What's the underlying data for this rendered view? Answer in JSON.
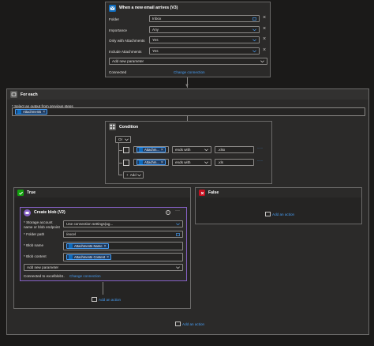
{
  "trigger": {
    "title": "When a new email arrives (V3)",
    "fields": [
      {
        "label": "Folder",
        "value": "Inbox"
      },
      {
        "label": "Importance",
        "value": "Any"
      },
      {
        "label": "Only with Attachments",
        "value": "Yes"
      },
      {
        "label": "Include Attachments",
        "value": "Yes"
      }
    ],
    "add_param": "Add new parameter",
    "connected_label": "Connected",
    "change_connection": "Change connection"
  },
  "foreach": {
    "title": "For each",
    "select_label": "* Select an output from previous steps",
    "token": "Attachments"
  },
  "condition": {
    "title": "Condition",
    "operator": "Or",
    "rows": [
      {
        "token": "Attachm...",
        "op": "ends with",
        "value": ".xlsx"
      },
      {
        "token": "Attachm...",
        "op": "ends with",
        "value": ".xls"
      }
    ],
    "add_label": "Add"
  },
  "true_branch": {
    "title": "True",
    "add_action": "Add an action",
    "blob": {
      "title": "Create blob (V2)",
      "fields": [
        {
          "label": "* Storage account name or blob endpoint",
          "value": "Use connection settings(ag..."
        },
        {
          "label": "* Folder path",
          "value": "/excel"
        },
        {
          "label": "* Blob name",
          "token": "Attachments Name"
        },
        {
          "label": "* Blob content",
          "token": "Attachments Content"
        }
      ],
      "add_param": "Add new parameter",
      "connected_label": "Connected to excelblob1.",
      "change_connection": "Change connection"
    }
  },
  "false_branch": {
    "title": "False",
    "add_action": "Add an action"
  },
  "bottom": {
    "add_action": "Add an action"
  },
  "colors": {
    "outlook_blue": "#0f6cbd",
    "control_gray": "#5c5b59",
    "true_green": "#13a10e",
    "false_red": "#c50f1f",
    "blob_purple": "#8661c5",
    "link": "#479ef5"
  }
}
